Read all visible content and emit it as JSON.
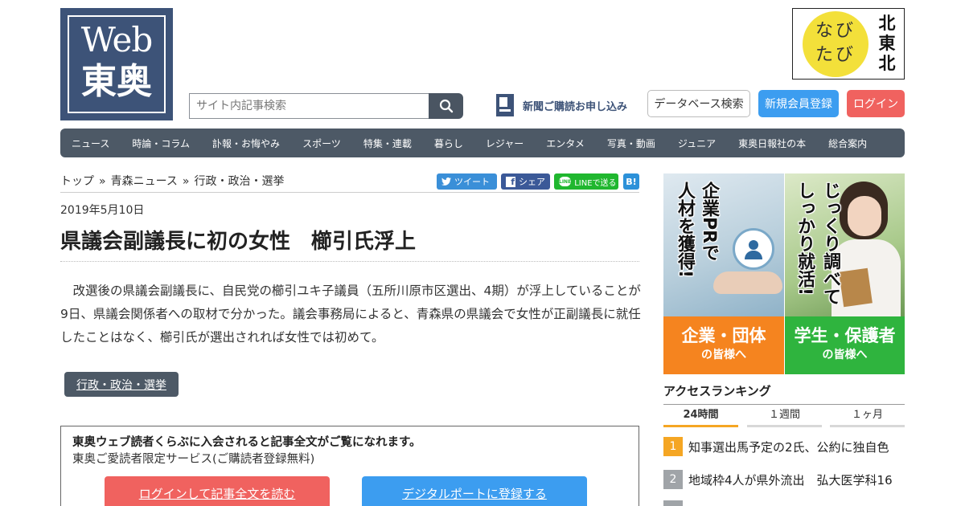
{
  "header": {
    "logo_line1": "Web",
    "logo_line2": "東奥",
    "search_placeholder": "サイト内記事検索",
    "search_icon": "search-icon",
    "subscribe_label": "新聞ご購読お申し込み",
    "database_label": "データベース検索",
    "register_label": "新規会員登録",
    "login_label": "ログイン",
    "navi_circle_line1": "なび",
    "navi_circle_line2": "たび",
    "navi_vertical": [
      "北",
      "東",
      "北"
    ]
  },
  "nav": [
    "ニュース",
    "時論・コラム",
    "訃報・お悔やみ",
    "スポーツ",
    "特集・連載",
    "暮らし",
    "レジャー",
    "エンタメ",
    "写真・動画",
    "ジュニア",
    "東奥日報社の本",
    "総合案内"
  ],
  "breadcrumb": {
    "top": "トップ",
    "category": "青森ニュース",
    "current": "行政・政治・選挙",
    "separator": "»"
  },
  "share": {
    "twitter": "ツイート",
    "facebook": "シェア",
    "line": "LINEで送る",
    "hatena": "B!"
  },
  "article": {
    "date": "2019年5月10日",
    "headline": "県議会副議長に初の女性　櫛引氏浮上",
    "body": "改選後の県議会副議長に、自民党の櫛引ユキ子議員（五所川原市区選出、4期）が浮上していることが9日、県議会関係者への取材で分かった。議会事務局によると、青森県の県議会で女性が正副議長に就任したことはなく、櫛引氏が選出されれば女性では初めて。",
    "tag": "行政・政治・選挙"
  },
  "member_box": {
    "title": "東奥ウェブ読者くらぶに入会されると記事全文がご覧になれます。",
    "subtitle": "東奥ご愛読者限定サービス(ご購読者登録無料)",
    "login_button": "ログインして記事全文を読む",
    "digital_button": "デジタルポートに登録する"
  },
  "banner": {
    "left_vertical": [
      "企業PRで",
      "人材を獲得!"
    ],
    "right_vertical": [
      "じっくり調べて",
      "しっかり就活!"
    ],
    "left_big": "企業・団体",
    "left_small": "の皆様へ",
    "right_big": "学生・保護者",
    "right_small": "の皆様へ"
  },
  "ranking": {
    "title": "アクセスランキング",
    "tabs": [
      "24時間",
      "１週間",
      "１ヶ月"
    ],
    "items": [
      {
        "rank": "1",
        "text": "知事選出馬予定の2氏、公約に独自色",
        "color": "#f5a623"
      },
      {
        "rank": "2",
        "text": "地域枠4人が県外流出　弘大医学科16",
        "color": "#a0a4a8"
      }
    ]
  },
  "colors": {
    "brand_navy": "#3d5378",
    "nav_bg": "#4d5966",
    "register_blue": "#3c9df0",
    "login_red": "#f0625f",
    "banner_orange": "#f5841f",
    "banner_green": "#2fb43e"
  }
}
